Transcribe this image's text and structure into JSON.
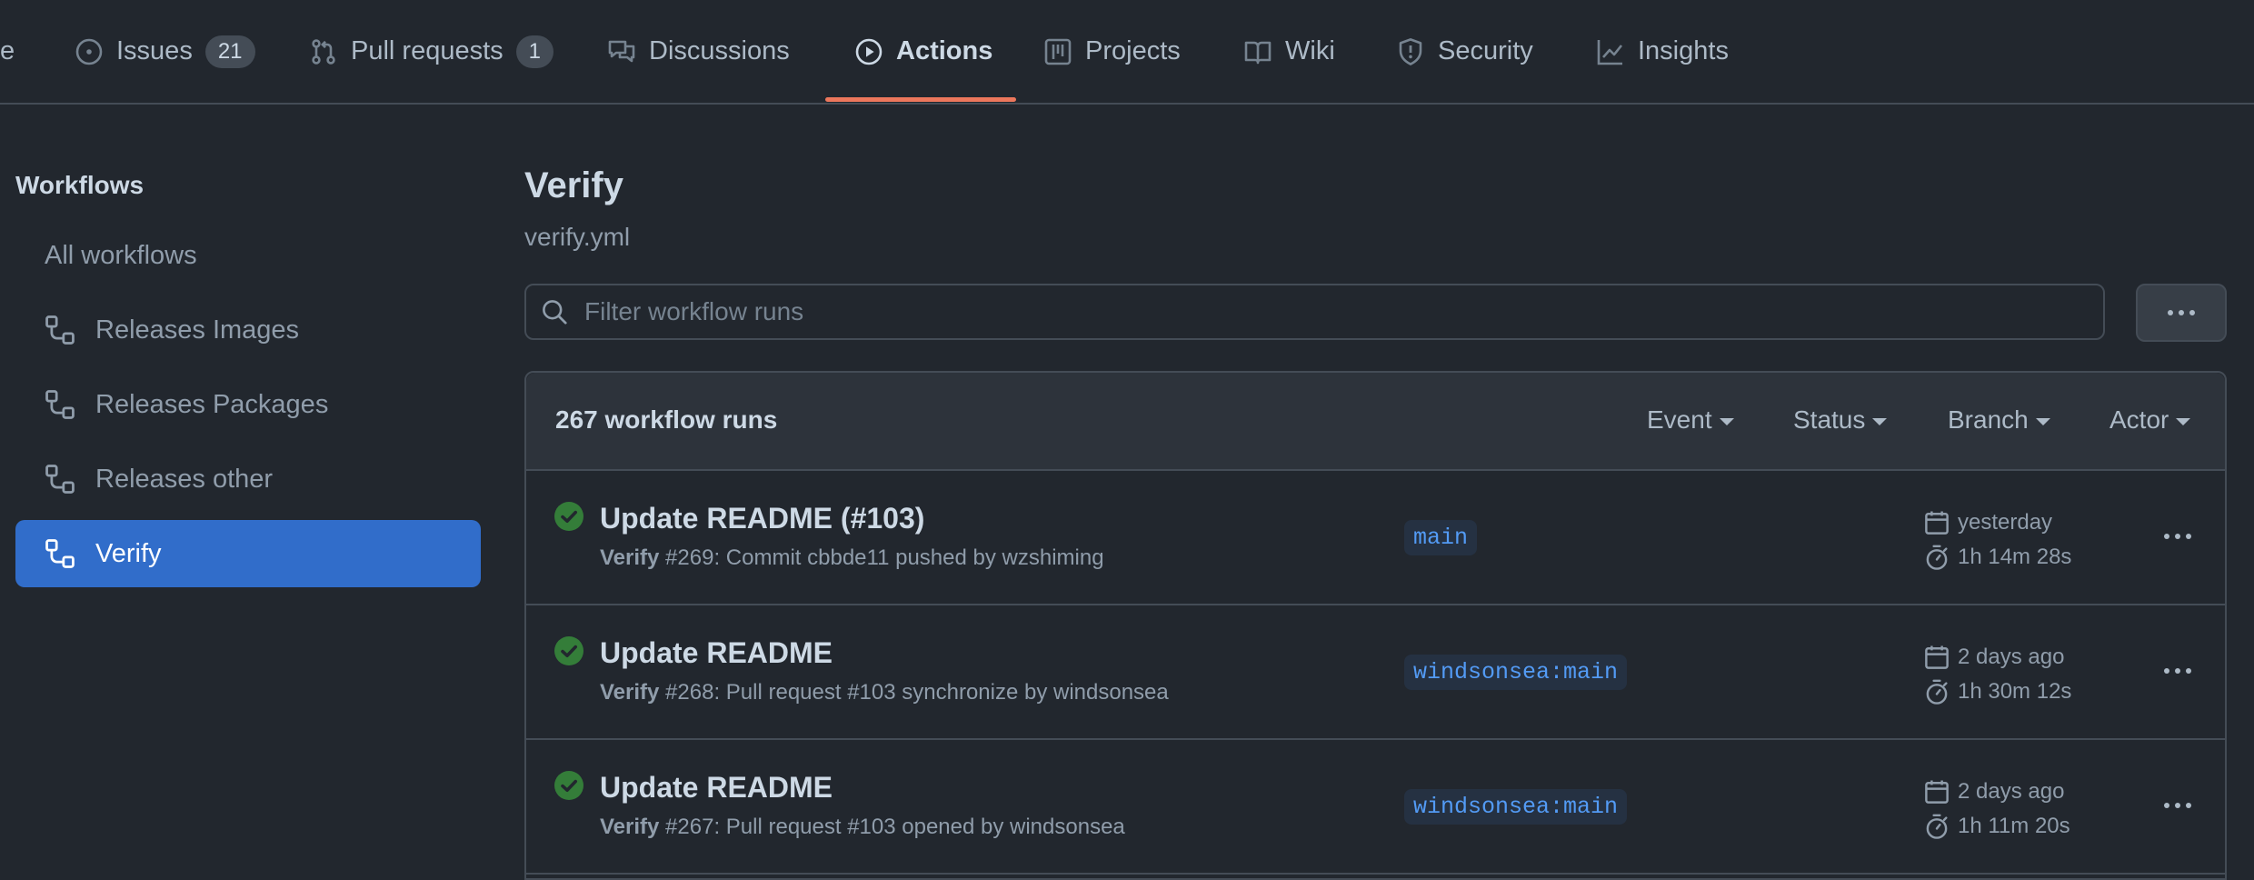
{
  "topnav": {
    "cut_label": "e",
    "issues_label": "Issues",
    "issues_count": "21",
    "pulls_label": "Pull requests",
    "pulls_count": "1",
    "discussions_label": "Discussions",
    "actions_label": "Actions",
    "projects_label": "Projects",
    "wiki_label": "Wiki",
    "security_label": "Security",
    "insights_label": "Insights"
  },
  "sidebar": {
    "title": "Workflows",
    "all": "All workflows",
    "items": [
      "Releases Images",
      "Releases Packages",
      "Releases other",
      "Verify"
    ]
  },
  "main": {
    "title": "Verify",
    "subtitle": "verify.yml",
    "filter_placeholder": "Filter workflow runs",
    "runs_count": "267 workflow runs",
    "filters": {
      "event": "Event",
      "status": "Status",
      "branch": "Branch",
      "actor": "Actor"
    }
  },
  "runs": [
    {
      "title": "Update README (#103)",
      "workflow": "Verify",
      "detail": " #269: Commit cbbde11 pushed by wzshiming",
      "branch": "main",
      "when": "yesterday",
      "duration": "1h 14m 28s"
    },
    {
      "title": "Update README",
      "workflow": "Verify",
      "detail": " #268: Pull request #103 synchronize by windsonsea",
      "branch": "windsonsea:main",
      "when": "2 days ago",
      "duration": "1h 30m 12s"
    },
    {
      "title": "Update README",
      "workflow": "Verify",
      "detail": " #267: Pull request #103 opened by windsonsea",
      "branch": "windsonsea:main",
      "when": "2 days ago",
      "duration": "1h 11m 20s"
    }
  ],
  "colors": {
    "background": "#22272e",
    "accent_underline": "#ec775c",
    "active_item": "#316dca",
    "success": "#347d39",
    "branch_text": "#539bf5"
  }
}
